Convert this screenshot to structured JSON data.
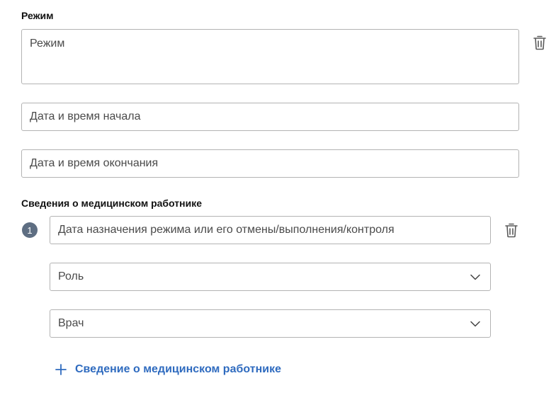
{
  "regime_section": {
    "title": "Режим",
    "regime_placeholder": "Режим",
    "start_placeholder": "Дата и время начала",
    "end_placeholder": "Дата и время окончания"
  },
  "medical_worker_section": {
    "title": "Сведения о медицинском работнике",
    "item_number": "1",
    "date_placeholder": "Дата назначения режима или его отмены/выполнения/контроля",
    "role_value": "Роль",
    "worker_value": "Врач",
    "add_label": "Сведение о медицинском работнике"
  },
  "icons": {
    "delete": "trash-icon",
    "dropdown": "chevron-down-icon",
    "add": "plus-icon"
  },
  "colors": {
    "accent": "#2f6bbf",
    "badge": "#5e6e82",
    "border": "#b3b3b3"
  }
}
